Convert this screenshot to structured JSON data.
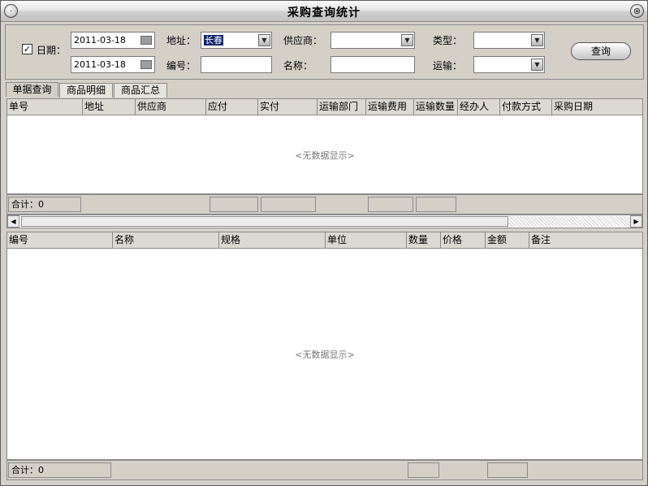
{
  "window": {
    "title": "采购查询统计",
    "sys_icon": "·",
    "close_icon": "⊗"
  },
  "filters": {
    "date_label": "日期：",
    "date_checked": true,
    "date_from": "2011-03-18",
    "date_to": "2011-03-18",
    "address_label": "地址：",
    "address_value": "长春",
    "number_label": "编号：",
    "number_value": "",
    "supplier_label": "供应商：",
    "supplier_value": "",
    "name_label": "名称：",
    "name_value": "",
    "type_label": "类型：",
    "type_value": "",
    "transport_label": "运输：",
    "transport_value": "",
    "query_button": "查询"
  },
  "tabs": [
    "单据查询",
    "商品明细",
    "商品汇总"
  ],
  "active_tab": 0,
  "orders_table": {
    "columns": [
      "单号",
      "地址",
      "供应商",
      "应付",
      "实付",
      "运输部门",
      "运输费用",
      "运输数量",
      "经办人",
      "付款方式",
      "采购日期"
    ],
    "rows": [],
    "empty_text": "<无数据显示>",
    "total_label": "合计：0"
  },
  "items_table": {
    "columns": [
      "编号",
      "名称",
      "规格",
      "单位",
      "数量",
      "价格",
      "金额",
      "备注"
    ],
    "rows": [],
    "empty_text": "<无数据显示>",
    "total_label": "合计：0"
  },
  "icons": {
    "check": "✓",
    "dropdown": "▼",
    "scroll_left": "◀",
    "scroll_right": "▶"
  },
  "colors": {
    "window_bg": "#d4d0c8",
    "selection": "#0a246a"
  }
}
